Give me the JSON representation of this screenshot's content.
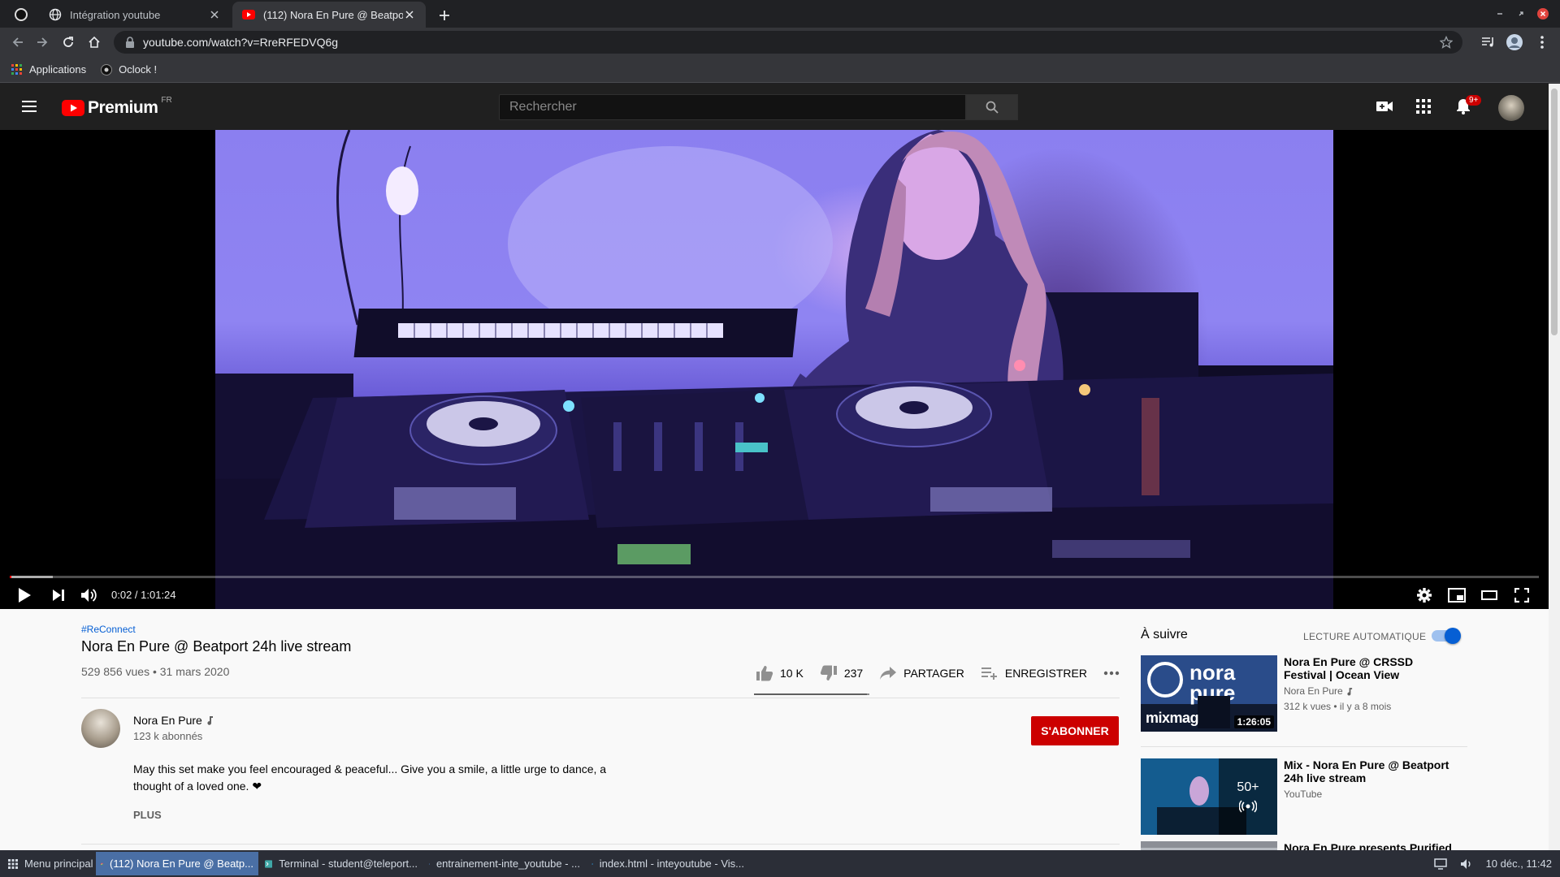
{
  "browser": {
    "tabs": [
      {
        "title": "Intégration youtube",
        "active": false
      },
      {
        "title": "(112) Nora En Pure @ Beatport 24h live stream",
        "active": true
      }
    ],
    "url": "youtube.com/watch?v=RreRFEDVQ6g",
    "bookmarks": [
      {
        "label": "Applications",
        "icon": "apps-grid-icon"
      },
      {
        "label": "Oclock !",
        "icon": "oclock-icon"
      }
    ]
  },
  "yt": {
    "logo_text": "Premium",
    "country_code": "FR",
    "search_placeholder": "Rechercher",
    "notifications_badge": "9+"
  },
  "player": {
    "current_time": "0:02",
    "duration": "1:01:24",
    "time_display": "0:02 / 1:01:24",
    "progress_fraction": 0.0005,
    "buffered_fraction": 0.028
  },
  "video": {
    "hashtag": "#ReConnect",
    "title": "Nora En Pure @ Beatport 24h live stream",
    "views_date": "529 856 vues • 31 mars 2020",
    "likes": "10 K",
    "dislikes": "237",
    "like_ratio": 0.977,
    "share_label": "PARTAGER",
    "save_label": "ENREGISTRER"
  },
  "channel": {
    "name": "Nora En Pure",
    "subscribers": "123 k abonnés",
    "subscribe_label": "S'ABONNER",
    "description_line1": "May this set make you feel encouraged & peaceful... Give you a smile, a little urge to dance, a",
    "description_line2": "thought of a loved one. ❤",
    "more_label": "PLUS"
  },
  "upnext": {
    "label": "À suivre",
    "autoplay_label": "LECTURE AUTOMATIQUE",
    "autoplay_on": true,
    "items": [
      {
        "title": "Nora En Pure @ CRSSD Festival | Ocean View",
        "channel": "Nora En Pure",
        "meta": "312 k vues • il y a 8 mois",
        "duration": "1:26:05",
        "thumb_text": "mixmag"
      },
      {
        "title": "Mix - Nora En Pure @ Beatport 24h live stream",
        "channel": "YouTube",
        "count": "50+"
      },
      {
        "title": "Nora En Pure presents Purified"
      }
    ]
  },
  "taskbar": {
    "menu_label": "Menu principal",
    "tasks": [
      {
        "label": "(112) Nora En Pure @ Beatp...",
        "active": true
      },
      {
        "label": "Terminal - student@teleport...",
        "active": false
      },
      {
        "label": "entrainement-inte_youtube - ...",
        "active": false
      },
      {
        "label": "index.html - inteyoutube - Vis...",
        "active": false
      }
    ],
    "clock": "10 déc., 11:42"
  },
  "colors": {
    "yt_red": "#ff0000",
    "subscribe_red": "#cc0000",
    "link_blue": "#065fd4",
    "header_dark": "#202020"
  }
}
